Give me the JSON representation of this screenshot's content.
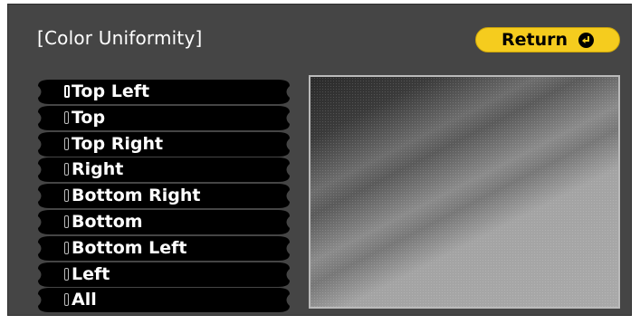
{
  "title": "[Color Uniformity]",
  "return_button": {
    "label": "Return",
    "icon": "return-icon"
  },
  "menu": {
    "selected_index": 0,
    "items": [
      {
        "label": "Top Left"
      },
      {
        "label": "Top"
      },
      {
        "label": "Top Right"
      },
      {
        "label": "Right"
      },
      {
        "label": "Bottom Right"
      },
      {
        "label": "Bottom"
      },
      {
        "label": "Bottom Left"
      },
      {
        "label": "Left"
      },
      {
        "label": "All"
      }
    ]
  },
  "colors": {
    "background": "#454545",
    "menu_pill": "#000000",
    "return_button": "#f5cc1e",
    "text": "#ffffff"
  }
}
